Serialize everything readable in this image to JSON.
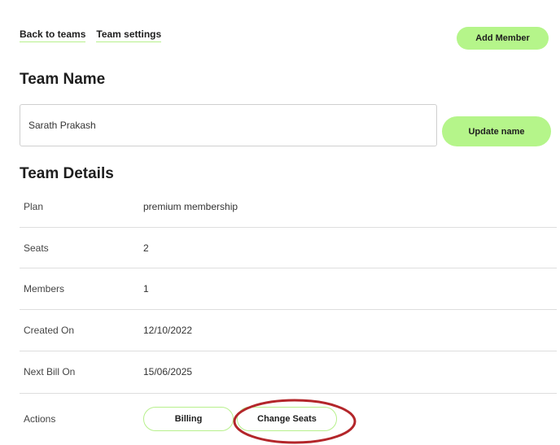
{
  "nav": {
    "back_label": "Back to teams",
    "settings_label": "Team settings"
  },
  "header": {
    "add_member_label": "Add Member"
  },
  "team_name": {
    "heading": "Team Name",
    "input_value": "Sarath Prakash",
    "update_label": "Update name"
  },
  "team_details": {
    "heading": "Team Details",
    "rows": [
      {
        "label": "Plan",
        "value": "premium membership"
      },
      {
        "label": "Seats",
        "value": "2"
      },
      {
        "label": "Members",
        "value": "1"
      },
      {
        "label": "Created On",
        "value": "12/10/2022"
      },
      {
        "label": "Next Bill On",
        "value": "15/06/2025"
      }
    ],
    "actions": {
      "label": "Actions",
      "billing_label": "Billing",
      "change_seats_label": "Change Seats"
    }
  },
  "colors": {
    "accent_green": "#b5f58a",
    "annotation_red": "#b3262a"
  }
}
